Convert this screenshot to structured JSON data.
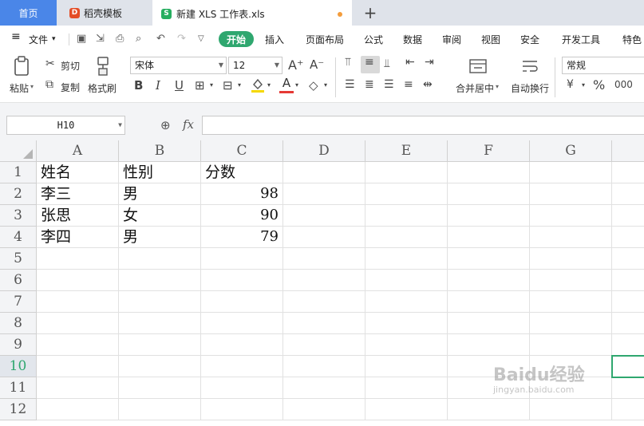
{
  "tabs": [
    {
      "label": "首页",
      "active": false
    },
    {
      "label": "稻壳模板",
      "active": false
    },
    {
      "label": "新建 XLS 工作表.xls",
      "active": true,
      "unsaved": true
    }
  ],
  "menu": {
    "file": "文件",
    "start": "开始",
    "items": [
      "插入",
      "页面布局",
      "公式",
      "数据",
      "审阅",
      "视图",
      "安全",
      "开发工具",
      "特色"
    ]
  },
  "ribbon": {
    "paste": "粘贴",
    "cut": "剪切",
    "copy": "复制",
    "format_painter": "格式刷",
    "font_name": "宋体",
    "font_size": "12",
    "bold": "B",
    "italic": "I",
    "underline": "U",
    "merge_center": "合并居中",
    "wrap_text": "自动换行",
    "number_format": "常规",
    "percent": "%",
    "thousands": "000"
  },
  "formula_bar": {
    "name_box": "H10",
    "fx": "fx",
    "formula": ""
  },
  "sheet": {
    "columns": [
      "A",
      "B",
      "C",
      "D",
      "E",
      "F",
      "G"
    ],
    "rows": [
      "1",
      "2",
      "3",
      "4",
      "5",
      "6",
      "7",
      "8",
      "9",
      "10",
      "11",
      "12"
    ],
    "active_row": "10",
    "active_cell": "H10",
    "data": [
      [
        "姓名",
        "性别",
        "分数"
      ],
      [
        "李三",
        "男",
        "98"
      ],
      [
        "张思",
        "女",
        "90"
      ],
      [
        "李四",
        "男",
        "79"
      ]
    ]
  },
  "watermark": {
    "text": "Baidu经验",
    "sub": "jingyan.baidu.com"
  },
  "colors": {
    "accent": "#2fa76f",
    "home_tab": "#4a86e8"
  }
}
